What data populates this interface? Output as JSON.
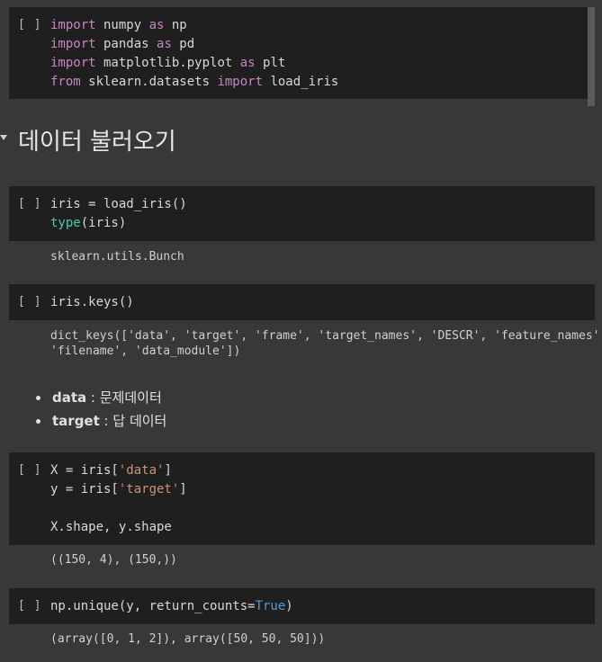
{
  "cells": [
    {
      "run_label": "[ ]",
      "lines": [
        [
          {
            "t": "import",
            "c": "kw"
          },
          {
            "t": " numpy ",
            "c": ""
          },
          {
            "t": "as",
            "c": "kw"
          },
          {
            "t": " np",
            "c": ""
          }
        ],
        [
          {
            "t": "import",
            "c": "kw"
          },
          {
            "t": " pandas ",
            "c": ""
          },
          {
            "t": "as",
            "c": "kw"
          },
          {
            "t": " pd",
            "c": ""
          }
        ],
        [
          {
            "t": "import",
            "c": "kw"
          },
          {
            "t": " matplotlib.pyplot ",
            "c": ""
          },
          {
            "t": "as",
            "c": "kw"
          },
          {
            "t": " plt",
            "c": ""
          }
        ],
        [
          {
            "t": "from",
            "c": "kw"
          },
          {
            "t": " sklearn.datasets ",
            "c": ""
          },
          {
            "t": "import",
            "c": "kw"
          },
          {
            "t": " load_iris",
            "c": ""
          }
        ]
      ],
      "output": ""
    },
    {
      "run_label": "[ ]",
      "lines": [
        [
          {
            "t": "iris = load_iris()",
            "c": ""
          }
        ],
        [
          {
            "t": "type",
            "c": "fn"
          },
          {
            "t": "(iris)",
            "c": ""
          }
        ]
      ],
      "output": "sklearn.utils.Bunch"
    },
    {
      "run_label": "[ ]",
      "lines": [
        [
          {
            "t": "iris.keys()",
            "c": ""
          }
        ]
      ],
      "output": "dict_keys(['data', 'target', 'frame', 'target_names', 'DESCR', 'feature_names',\n'filename', 'data_module'])"
    },
    {
      "run_label": "[ ]",
      "lines": [
        [
          {
            "t": "X = iris[",
            "c": ""
          },
          {
            "t": "'data'",
            "c": "str"
          },
          {
            "t": "]",
            "c": ""
          }
        ],
        [
          {
            "t": "y = iris[",
            "c": ""
          },
          {
            "t": "'target'",
            "c": "str"
          },
          {
            "t": "]",
            "c": ""
          }
        ],
        [
          {
            "t": "",
            "c": ""
          }
        ],
        [
          {
            "t": "X.shape, y.shape",
            "c": ""
          }
        ]
      ],
      "output": "((150, 4), (150,))"
    },
    {
      "run_label": "[ ]",
      "lines": [
        [
          {
            "t": "np.unique(y, return_counts=",
            "c": ""
          },
          {
            "t": "True",
            "c": "const"
          },
          {
            "t": ")",
            "c": ""
          }
        ]
      ],
      "output": "(array([0, 1, 2]), array([50, 50, 50]))"
    }
  ],
  "section": {
    "heading": "데이터 불러오기"
  },
  "markdown": {
    "bullets": [
      {
        "term": "data",
        "desc": " : 문제데이터"
      },
      {
        "term": "target",
        "desc": " : 답 데이터"
      }
    ]
  }
}
